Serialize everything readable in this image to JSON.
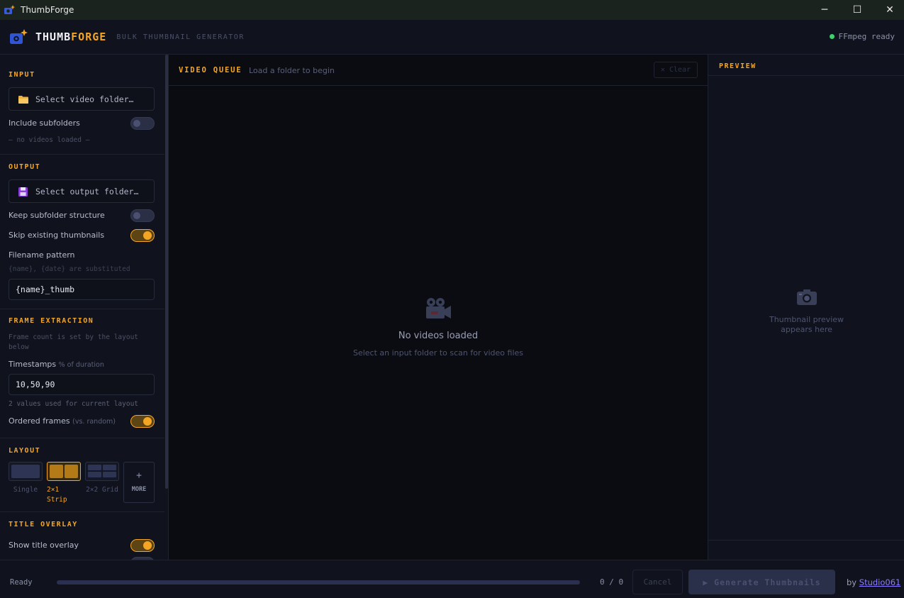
{
  "window": {
    "title": "ThumbForge",
    "minimize": "─",
    "maximize": "☐",
    "close": "✕"
  },
  "header": {
    "brand_part1": "THUMB",
    "brand_part2": "FORGE",
    "tagline": "BULK THUMBNAIL GENERATOR",
    "ffmpeg_status": "FFmpeg ready"
  },
  "sidebar": {
    "input": {
      "title": "INPUT",
      "folder_picker": "Select video folder…",
      "include_subfolders_label": "Include subfolders",
      "include_subfolders": false,
      "videos_status": "— no videos loaded —"
    },
    "output": {
      "title": "OUTPUT",
      "folder_picker": "Select output folder…",
      "keep_structure_label": "Keep subfolder structure",
      "keep_structure": false,
      "skip_existing_label": "Skip existing thumbnails",
      "skip_existing": true,
      "filename_label": "Filename pattern",
      "filename_hint": "{name}, {date} are substituted",
      "filename_value": "{name}_thumb"
    },
    "frames": {
      "title": "FRAME EXTRACTION",
      "hint": "Frame count is set by the layout below",
      "timestamps_label": "Timestamps",
      "timestamps_unit": "% of duration",
      "timestamps_value": "10,50,90",
      "values_hint": "2 values used for current layout",
      "ordered_label": "Ordered frames",
      "ordered_note": "(vs. random)",
      "ordered": true
    },
    "layout": {
      "title": "LAYOUT",
      "options": [
        {
          "label": "Single",
          "selected": false
        },
        {
          "label": "2×1 Strip",
          "selected": true
        },
        {
          "label": "2×2 Grid",
          "selected": false
        }
      ],
      "more_plus": "+",
      "more_label": "MORE"
    },
    "title_overlay": {
      "title": "TITLE OVERLAY",
      "show_label": "Show title overlay",
      "show": true
    }
  },
  "queue": {
    "title": "VIDEO QUEUE",
    "subtitle": "Load a folder to begin",
    "clear_button": "✕ Clear",
    "empty_title": "No videos loaded",
    "empty_subtitle": "Select an input folder to scan for video files"
  },
  "preview": {
    "title": "PREVIEW",
    "placeholder_line1": "Thumbnail preview",
    "placeholder_line2": "appears here"
  },
  "statusbar": {
    "status": "Ready",
    "progress": 0,
    "counter": "0 / 0",
    "cancel": "Cancel",
    "generate": "▶ Generate Thumbnails",
    "by_prefix": "by",
    "by_link": "Studio061"
  },
  "colors": {
    "accent": "#f5a524",
    "status_ok": "#3ecf70",
    "background": "#0a0c12",
    "panel": "#10131d"
  }
}
